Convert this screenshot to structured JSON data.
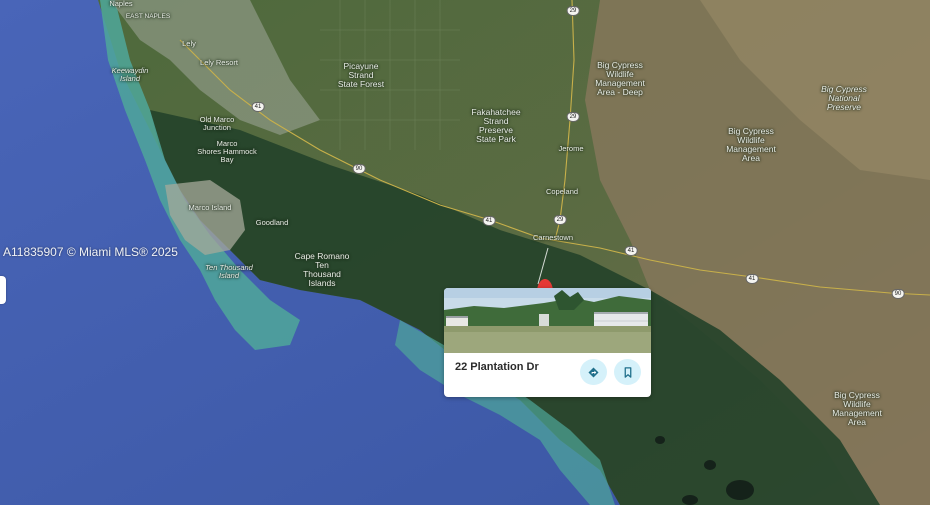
{
  "map": {
    "labels": {
      "naples": "Naples",
      "east_naples": "EAST NAPLES",
      "lely": "Lely",
      "lely_resort": "Lely Resort",
      "keewaydin": "Keewaydin\nIsland",
      "old_marco": "Old Marco\nJunction",
      "marco_shores": "Marco\nShores Hammock\nBay",
      "marco_island": "Marco Island",
      "goodland": "Goodland",
      "ten_thousand_island": "Ten Thousand\nIsland",
      "cape_romano": "Cape Romano\nTen\nThousand\nIslands",
      "picayune": "Picayune\nStrand\nState Forest",
      "fakahatchee": "Fakahatchee\nStrand\nPreserve\nState Park",
      "jerome": "Jerome",
      "copeland": "Copeland",
      "carnestown": "Carnestown",
      "big_cypress_wma_deep": "Big Cypress\nWildlife\nManagement\nArea - Deep",
      "big_cypress_national": "Big Cypress\nNational\nPreserve",
      "big_cypress_wma_mid": "Big Cypress\nWildlife\nManagement\nArea",
      "big_cypress_wma_low": "Big Cypress\nWildlife\nManagement\nArea"
    },
    "shields": {
      "r41_a": "41",
      "r41_b": "41",
      "r41_c": "41",
      "r41_d": "41",
      "r29_a": "29",
      "r29_b": "29",
      "r29_c": "29",
      "r90_a": "90",
      "r90_b": "90"
    },
    "colors": {
      "water": "#3f5fae",
      "coast": "#4aa398",
      "wetland": "#24472a",
      "land": "#556f3f",
      "upland": "#8a7a5b",
      "road": "#c9b24a"
    }
  },
  "watermark": "A11835907 © Miami MLS® 2025",
  "listing_card": {
    "address": "22 Plantation Dr",
    "pin_color": "#e53935",
    "directions_icon": "directions-icon",
    "save_icon": "bookmark-icon"
  }
}
